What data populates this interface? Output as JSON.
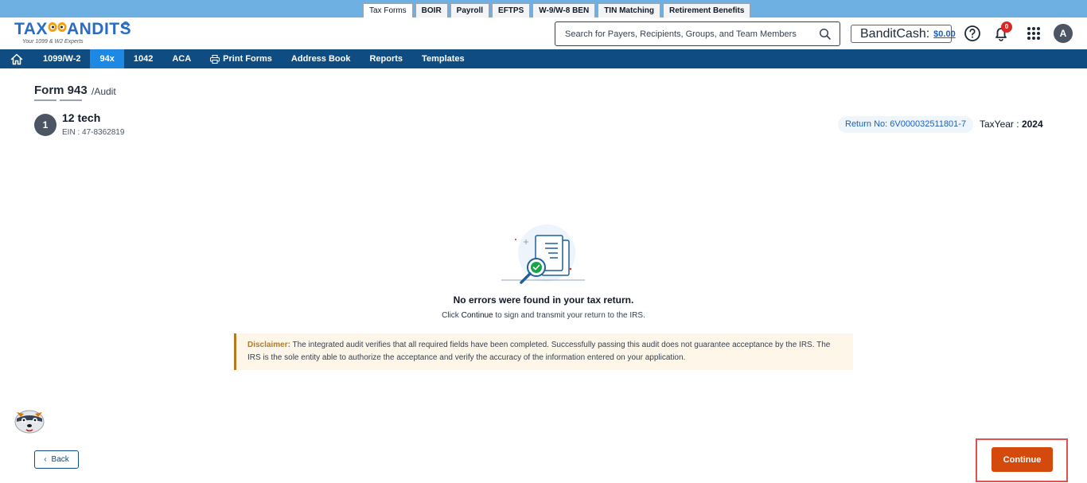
{
  "product_tabs": [
    {
      "label": "Tax Forms",
      "active": true
    },
    {
      "label": "BOIR",
      "active": false
    },
    {
      "label": "Payroll",
      "active": false
    },
    {
      "label": "EFTPS",
      "active": false
    },
    {
      "label": "W-9/W-8 BEN",
      "active": false
    },
    {
      "label": "TIN Matching",
      "active": false
    },
    {
      "label": "Retirement Benefits",
      "active": false
    }
  ],
  "header": {
    "logo_text_left": "TAX",
    "logo_text_right": "ANDITS",
    "logo_tagline": "Your 1099 & W2 Experts",
    "search_placeholder": "Search for Payers, Recipients, Groups, and Team Members",
    "bandit_cash_label": "BanditCash:",
    "bandit_cash_value": "$0.00",
    "notification_count": "0",
    "avatar_initial": "A"
  },
  "nav": {
    "items": [
      {
        "label": "1099/W-2",
        "active": false
      },
      {
        "label": "94x",
        "active": true
      },
      {
        "label": "1042",
        "active": false
      },
      {
        "label": "ACA",
        "active": false
      },
      {
        "label": "Print Forms",
        "active": false,
        "icon": "printer-icon"
      },
      {
        "label": "Address Book",
        "active": false
      },
      {
        "label": "Reports",
        "active": false
      },
      {
        "label": "Templates",
        "active": false
      }
    ]
  },
  "page": {
    "form_title": "Form 943",
    "form_subtitle": "/Audit",
    "step_number": "1",
    "business_name": "12 tech",
    "ein": "EIN : 47-8362819",
    "return_no": "Return No: 6V000032511801-7",
    "tax_year_label": "TaxYear :",
    "tax_year_value": "2024"
  },
  "result": {
    "main_message": "No errors were found in your tax return.",
    "sub_prefix": "Click",
    "sub_keyword": "Continue",
    "sub_suffix": "to sign and transmit your return to the IRS."
  },
  "disclaimer": {
    "label": "Disclaimer:",
    "text": "The integrated audit verifies that all required fields have been completed. Successfully passing this audit does not guarantee acceptance by the IRS. The IRS is the sole entity able to authorize the acceptance and verify the accuracy of the information entered on your application."
  },
  "actions": {
    "back_label": "Back",
    "continue_label": "Continue"
  },
  "colors": {
    "nav_bg": "#0f4c81",
    "nav_active": "#1e88e5",
    "continue_btn": "#d44a0c",
    "highlight_frame": "#e05252",
    "disclaimer_accent": "#b7791f"
  }
}
